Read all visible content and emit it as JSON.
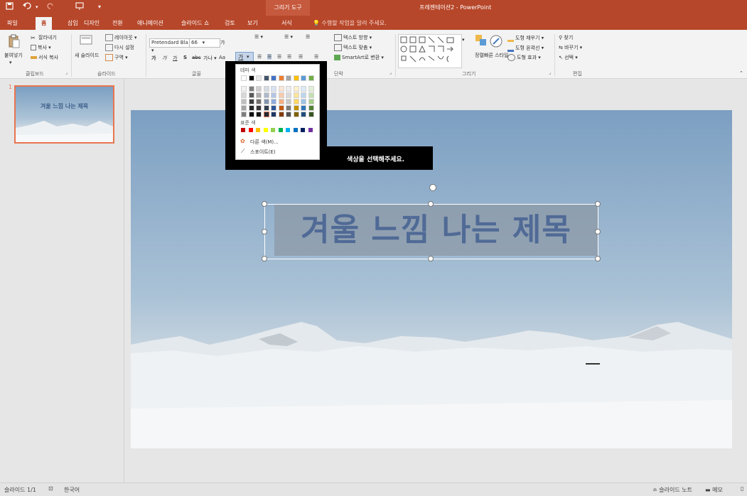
{
  "window": {
    "doc_title": "프레젠테이션2 - PowerPoint",
    "context_tab": "그리기 도구",
    "qa_icons": [
      "save-icon",
      "undo-icon",
      "redo-icon",
      "slideshow-icon",
      "customize-icon"
    ]
  },
  "tabs": [
    "파일",
    "홈",
    "삽입",
    "디자인",
    "전환",
    "애니메이션",
    "슬라이드 쇼",
    "검토",
    "보기",
    "서식"
  ],
  "tell_me": "수행할 작업을 알려 주세요.",
  "ribbon": {
    "clipboard": {
      "paste": "붙여넣기",
      "cut": "잘라내기",
      "copy": "복사",
      "format_painter": "서식 복사",
      "label": "클립보드"
    },
    "slides": {
      "new_slide": "새 슬라이드",
      "layout": "레이아웃",
      "reset": "다시 설정",
      "section": "구역",
      "label": "슬라이드"
    },
    "font": {
      "font_name": "Pretendard Bla",
      "font_size": "66",
      "bold": "가",
      "italic": "가",
      "underline": "가",
      "strike": "S",
      "spacing": "가나",
      "change_case": "Aa",
      "font_color": "가",
      "grow": "가",
      "label": "글꼴"
    },
    "paragraph": {
      "text_direction": "텍스트 방향",
      "align_text": "텍스트 맞춤",
      "smartart": "SmartArt로 변환",
      "label": "단락"
    },
    "drawing": {
      "arrange": "정렬",
      "quick_styles": "빠른 스타일",
      "fill": "도형 채우기",
      "outline": "도형 윤곽선",
      "effects": "도형 효과",
      "label": "그리기"
    },
    "editing": {
      "find": "찾기",
      "replace": "바꾸기",
      "select": "선택",
      "label": "편집"
    }
  },
  "thumbnail": {
    "number": "1",
    "title": "겨울 느낌 나는 제목"
  },
  "slide": {
    "title": "겨울 느낌 나는 제목"
  },
  "color_menu": {
    "theme_label": "테마 색",
    "standard_label": "표준 색",
    "more_colors": "다른 색(M)...",
    "eyedropper": "스포이트(E)",
    "theme_colors": [
      [
        "#ffffff",
        "#000000",
        "#e7e6e6",
        "#44546a",
        "#4472c4",
        "#ed7d31",
        "#a5a5a5",
        "#ffc000",
        "#5b9bd5",
        "#70ad47"
      ],
      [
        "#f2f2f2",
        "#7f7f7f",
        "#d0cece",
        "#d6dce4",
        "#d9e2f3",
        "#fbe5d5",
        "#ededed",
        "#fff2cc",
        "#deebf6",
        "#e2efd9"
      ],
      [
        "#d8d8d8",
        "#595959",
        "#aeabab",
        "#adb9ca",
        "#b4c6e7",
        "#f7cbac",
        "#dbdbdb",
        "#fee599",
        "#bdd7ee",
        "#c5e0b3"
      ],
      [
        "#bfbfbf",
        "#3f3f3f",
        "#757070",
        "#8496b0",
        "#8eaadb",
        "#f4b183",
        "#c9c9c9",
        "#ffd965",
        "#9dc3e6",
        "#a8d08d"
      ],
      [
        "#a5a5a5",
        "#262626",
        "#3a3838",
        "#323f4f",
        "#2f5496",
        "#c55a11",
        "#7b7b7b",
        "#bf9000",
        "#2e75b5",
        "#538135"
      ],
      [
        "#7f7f7f",
        "#0c0c0c",
        "#171616",
        "#222a35",
        "#1f3864",
        "#833c0b",
        "#525252",
        "#7f6000",
        "#1e4e79",
        "#375623"
      ]
    ],
    "standard_colors": [
      "#c00000",
      "#ff0000",
      "#ffc000",
      "#ffff00",
      "#92d050",
      "#00b050",
      "#00b0f0",
      "#0070c0",
      "#002060",
      "#7030a0"
    ],
    "selected": "#222a35"
  },
  "callout": "색상을 선택해주세요.",
  "status": {
    "slide_count": "슬라이드 1/1",
    "language": "한국어",
    "notes": "슬라이드 노트",
    "comments": "메모"
  }
}
